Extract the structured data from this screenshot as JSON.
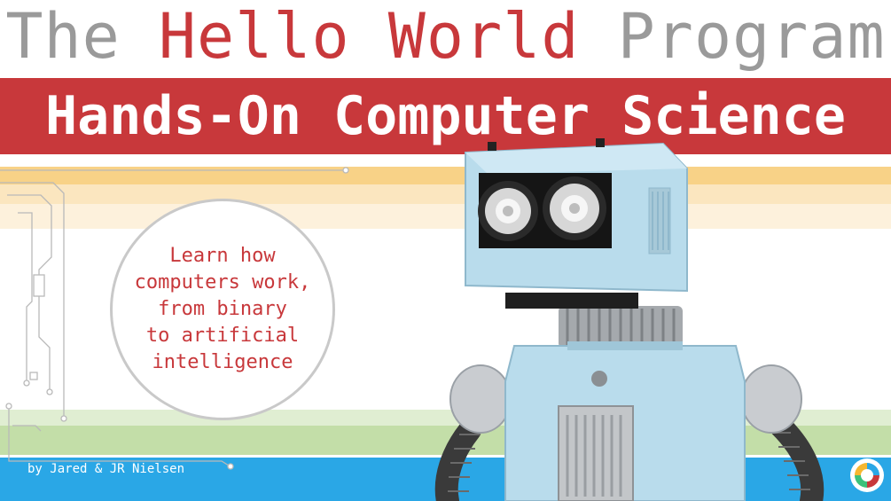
{
  "title": {
    "word1": "The",
    "word2": "Hello",
    "word3": "World",
    "word4": "Program"
  },
  "subtitle": "Hands-On Computer Science",
  "tagline": {
    "line1": "Learn how",
    "line2": "computers work,",
    "line3": "from binary",
    "line4": "to artificial",
    "line5": "intelligence"
  },
  "byline": "by Jared & JR Nielsen",
  "colors": {
    "red": "#c8383b",
    "gray": "#9a9a9a",
    "stripe_orange": "#f8d287",
    "stripe_light_orange": "#fbe6bf",
    "stripe_green": "#c3dea8",
    "stripe_light_green": "#e0eed2",
    "stripe_blue": "#2aa7e6",
    "robot_body": "#b9dcec"
  },
  "icons": [
    "circuit-trace",
    "robot-illustration",
    "publisher-logo-icon"
  ]
}
